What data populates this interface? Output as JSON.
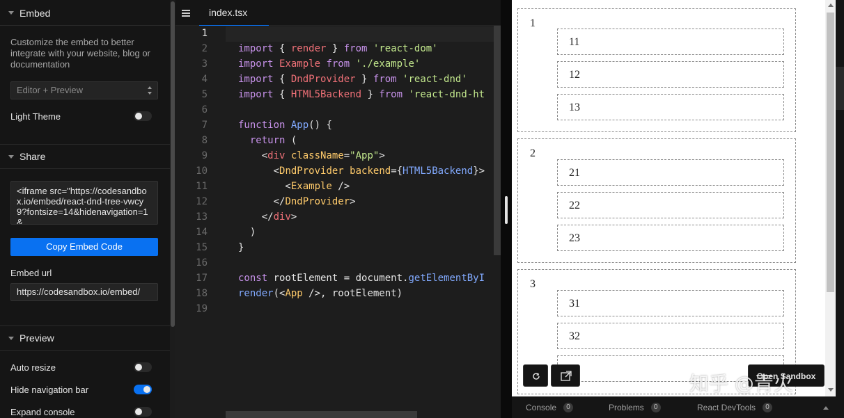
{
  "sidebar": {
    "embed": {
      "title": "Embed",
      "description": "Customize the embed to better integrate with your website, blog or documentation",
      "view_select": "Editor + Preview",
      "light_theme_label": "Light Theme",
      "light_theme_on": false
    },
    "share": {
      "title": "Share",
      "embed_code": "<iframe src=\"https://codesandbox.io/embed/react-dnd-tree-vwcy9?fontsize=14&hidenavigation=1&",
      "copy_button": "Copy Embed Code",
      "embed_url_label": "Embed url",
      "embed_url": "https://codesandbox.io/embed/"
    },
    "preview": {
      "title": "Preview",
      "auto_resize_label": "Auto resize",
      "auto_resize_on": false,
      "hide_nav_label": "Hide navigation bar",
      "hide_nav_on": true,
      "expand_console_label": "Expand console",
      "expand_console_on": false
    }
  },
  "editor": {
    "tab": "index.tsx",
    "line_numbers": [
      "1",
      "2",
      "3",
      "4",
      "5",
      "6",
      "7",
      "8",
      "9",
      "10",
      "11",
      "12",
      "13",
      "14",
      "15",
      "16",
      "17",
      "18",
      "19"
    ],
    "active_line": "1"
  },
  "preview_pane": {
    "groups": [
      {
        "label": "1",
        "items": [
          "11",
          "12",
          "13"
        ]
      },
      {
        "label": "2",
        "items": [
          "21",
          "22",
          "23"
        ]
      },
      {
        "label": "3",
        "items": [
          "31",
          "32"
        ]
      }
    ],
    "open_sandbox": "Open Sandbox",
    "watermark": "知乎 @青火"
  },
  "console_bar": {
    "console_label": "Console",
    "console_count": "0",
    "problems_label": "Problems",
    "problems_count": "0",
    "devtools_label": "React DevTools",
    "devtools_count": "0"
  },
  "colors": {
    "accent": "#0971f1",
    "background": "#151515",
    "editor_bg": "#1d1d1d"
  }
}
